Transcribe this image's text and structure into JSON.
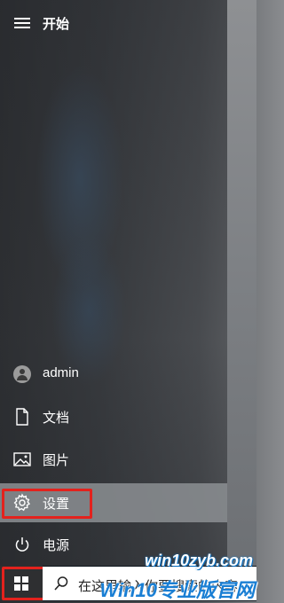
{
  "start_menu": {
    "title": "开始",
    "items": [
      {
        "label": "admin",
        "icon": "user-avatar-icon"
      },
      {
        "label": "文档",
        "icon": "document-icon"
      },
      {
        "label": "图片",
        "icon": "pictures-icon"
      },
      {
        "label": "设置",
        "icon": "gear-icon",
        "selected": true
      },
      {
        "label": "电源",
        "icon": "power-icon"
      }
    ]
  },
  "taskbar": {
    "search_placeholder": "在这里输入你要搜索的内容"
  },
  "watermark": {
    "line1": "win10zyb.com",
    "line2": "Win10专业版官网"
  },
  "colors": {
    "highlight": "#e3221d",
    "selected_bg": "#8c8f93",
    "taskbar_bg": "#101820"
  }
}
